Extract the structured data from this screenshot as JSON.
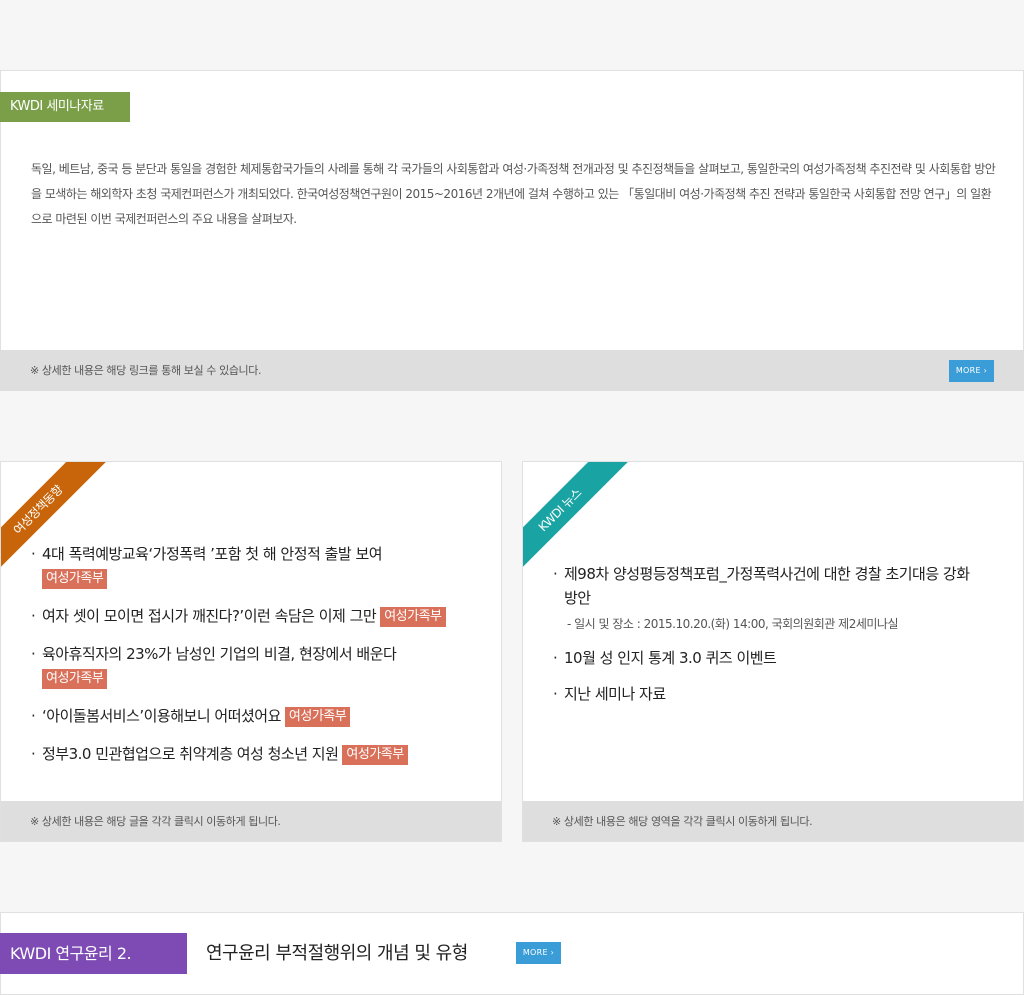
{
  "seminar": {
    "tag": "KWDI 세미나자료",
    "description": "독일, 베트남, 중국 등 분단과 통일을 경험한 체제통합국가들의 사례를 통해 각 국가들의 사회통합과 여성·가족정책 전개과정 및 추진정책들을 살펴보고, 통일한국의 여성가족정책 추진전략 및 사회통합 방안을 모색하는 해외학자 초청 국제컨퍼런스가 개최되었다. 한국여성정책연구원이 2015~2016년 2개년에 걸쳐 수행하고 있는 「통일대비 여성·가족정책 추진 전략과 통일한국 사회통합 전망 연구」의 일환으로 마련된 이번 국제컨퍼런스의 주요 내용을 살펴보자.",
    "footer_note": "※ 상세한 내용은 해당 링크를 통해 보실 수 있습니다.",
    "more_label": "MORE ›"
  },
  "policy": {
    "ribbon": "여성정책동향",
    "items": [
      {
        "title": "4대 폭력예방교육‘가정폭력 ’포함 첫 해 안정적 출발 보여",
        "badge": "여성가족부"
      },
      {
        "title": "여자 셋이 모이면 접시가 깨진다?’이런 속담은 이제 그만",
        "badge": "여성가족부"
      },
      {
        "title": "육아휴직자의 23%가 남성인 기업의 비결, 현장에서 배운다",
        "badge": "여성가족부"
      },
      {
        "title": "‘아이돌봄서비스’이용해보니 어떠셨어요",
        "badge": "여성가족부"
      },
      {
        "title": "정부3.0 민관협업으로 취약계층 여성 청소년 지원",
        "badge": "여성가족부"
      }
    ],
    "footer_note": "※ 상세한 내용은 해당 글을 각각 클릭시 이동하게 됩니다."
  },
  "news": {
    "ribbon": "KWDI 뉴스",
    "items": [
      {
        "title": "제98차 양성평등정책포럼_가정폭력사건에 대한 경찰 초기대응 강화 방안",
        "note": "-  일시 및 장소 : 2015.10.20.(화) 14:00, 국회의원회관 제2세미나실"
      },
      {
        "title": "10월 성 인지 통계 3.0 퀴즈 이벤트"
      },
      {
        "title": "지난 세미나 자료"
      }
    ],
    "footer_note": "※ 상세한 내용은 해당 영역을 각각 클릭시 이동하게 됩니다."
  },
  "ethics": {
    "tag": "KWDI 연구윤리 2.",
    "title": "연구윤리 부적절행위의 개념 및 유형",
    "more_label": "MORE ›"
  },
  "colors": {
    "seminar_tag": "#7b9f49",
    "policy_ribbon": "#c8650b",
    "news_ribbon": "#1aa3a3",
    "badge": "#d9705a",
    "ethics_tag": "#7d4bb3",
    "more_button": "#3a9dd8"
  }
}
